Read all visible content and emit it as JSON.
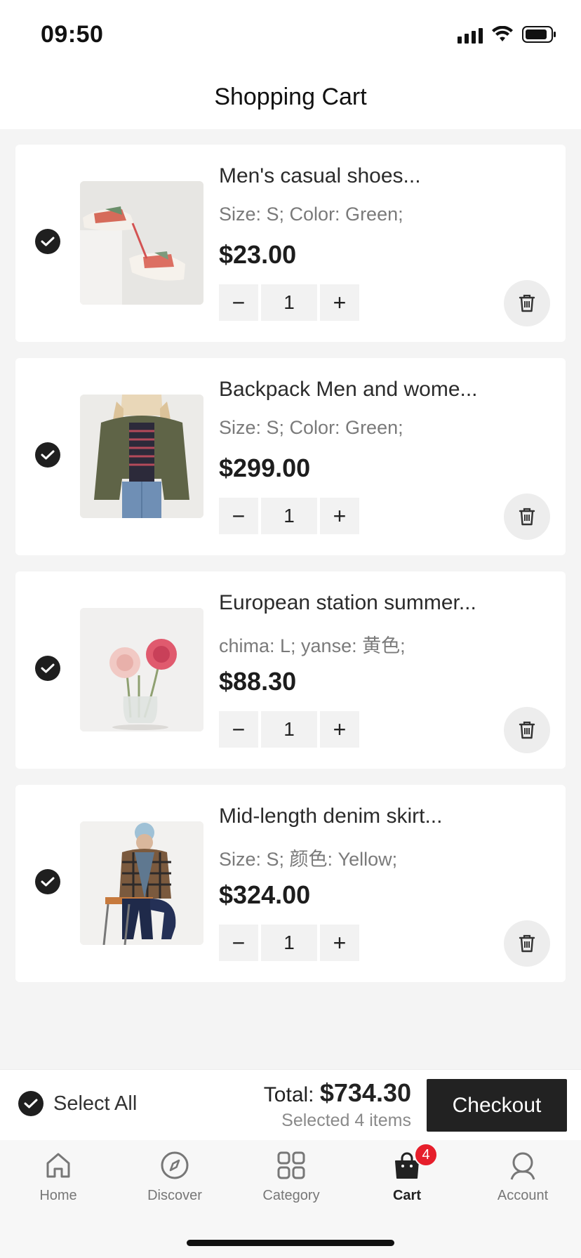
{
  "status_bar": {
    "time": "09:50"
  },
  "header": {
    "title": "Shopping Cart"
  },
  "cart": {
    "items": [
      {
        "title": "Men's casual shoes...",
        "spec": "Size: S; Color: Green;",
        "price": "$23.00",
        "quantity": "1",
        "selected": true,
        "image": "sneakers-photo"
      },
      {
        "title": "Backpack Men and wome...",
        "spec": "Size: S; Color: Green;",
        "price": "$299.00",
        "quantity": "1",
        "selected": true,
        "image": "jacket-model-photo"
      },
      {
        "title": "European station summer...",
        "spec": "chima: L; yanse: 黄色;",
        "price": "$88.30",
        "quantity": "1",
        "selected": true,
        "image": "flowers-vase-photo"
      },
      {
        "title": "Mid-length denim skirt...",
        "spec": "Size: S; 颜色: Yellow;",
        "price": "$324.00",
        "quantity": "1",
        "selected": true,
        "image": "plaid-jacket-model-photo"
      }
    ],
    "minus_symbol": "−",
    "plus_symbol": "+"
  },
  "checkout_bar": {
    "select_all_label": "Select All",
    "total_label": "Total:",
    "total_amount": "$734.30",
    "selected_text": "Selected 4 items",
    "checkout_label": "Checkout"
  },
  "tab_bar": {
    "tabs": [
      {
        "label": "Home",
        "icon": "home-icon",
        "active": false
      },
      {
        "label": "Discover",
        "icon": "compass-icon",
        "active": false
      },
      {
        "label": "Category",
        "icon": "grid-icon",
        "active": false
      },
      {
        "label": "Cart",
        "icon": "shopping-bag-icon",
        "active": true,
        "badge": "4"
      },
      {
        "label": "Account",
        "icon": "user-icon",
        "active": false
      }
    ]
  },
  "colors": {
    "accent": "#222222",
    "badge": "#e61e2b",
    "background": "#f4f4f4"
  }
}
